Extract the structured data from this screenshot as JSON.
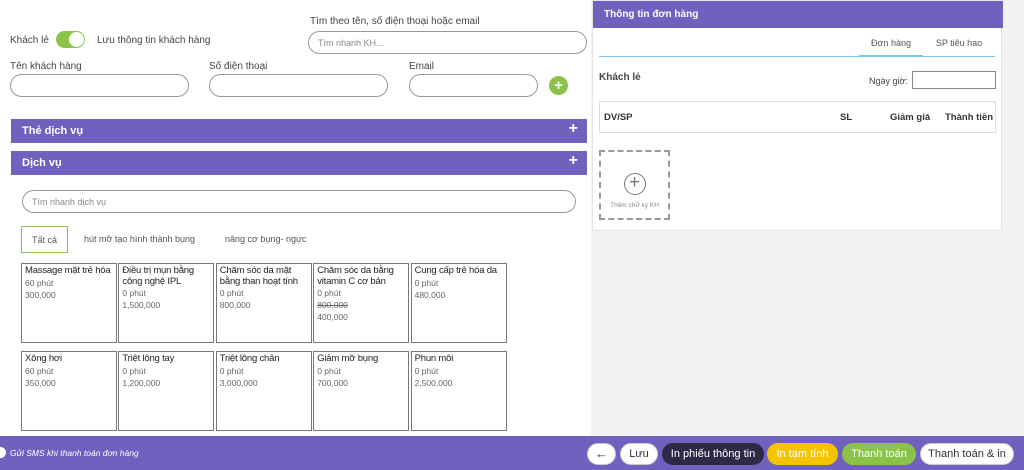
{
  "customer": {
    "walk_in_label": "Khách lẻ",
    "save_info_label": "Lưu thông tin khách hàng",
    "search_label": "Tìm theo tên, số điện thoại hoặc email",
    "search_placeholder": "Tìm nhanh KH...",
    "name_label": "Tên khách hàng",
    "phone_label": "Số điện thoại",
    "email_label": "Email",
    "add_icon": "plus-icon"
  },
  "service_card_section": {
    "title": "Thẻ dịch vụ",
    "expand": "+"
  },
  "service_section": {
    "title": "Dịch vụ",
    "expand": "+",
    "search_placeholder": "Tìm nhanh dịch vụ",
    "tabs": [
      "Tất cả",
      "hút mỡ tạo hình thành bụng",
      "nâng cơ bụng- ngực"
    ],
    "services": [
      {
        "name": "Massage mặt trẻ hóa",
        "duration": "60 phút",
        "price": "300,000",
        "old_price": ""
      },
      {
        "name": "Điều trị mụn bằng công nghệ IPL",
        "duration": "0 phút",
        "price": "1,500,000",
        "old_price": ""
      },
      {
        "name": "Chăm sóc da mặt bằng than hoạt tính",
        "duration": "0 phút",
        "price": "800,000",
        "old_price": ""
      },
      {
        "name": "Chăm sóc da bằng vitamin C cơ bản",
        "duration": "0 phút",
        "price": "400,000",
        "old_price": "800,000"
      },
      {
        "name": "Cung cấp trẻ hóa da",
        "duration": "0 phút",
        "price": "480,000",
        "old_price": ""
      },
      {
        "name": "Xông hơi",
        "duration": "60 phút",
        "price": "350,000",
        "old_price": ""
      },
      {
        "name": "Triệt lông tay",
        "duration": "0 phút",
        "price": "1,200,000",
        "old_price": ""
      },
      {
        "name": "Triệt lông chân",
        "duration": "0 phút",
        "price": "3,000,000",
        "old_price": ""
      },
      {
        "name": "Giảm mỡ bụng",
        "duration": "0 phút",
        "price": "700,000",
        "old_price": ""
      },
      {
        "name": "Phun môi",
        "duration": "0 phút",
        "price": "2,500,000",
        "old_price": ""
      }
    ]
  },
  "order": {
    "title": "Thông tin đơn hàng",
    "tabs": [
      "Đơn hàng",
      "SP tiêu hao"
    ],
    "customer_name": "Khách lẻ",
    "date_label": "Ngày giờ:",
    "columns": [
      "DV/SP",
      "SL",
      "Giảm giá",
      "Thành tiền"
    ],
    "signature_label": "Thêm chữ ký KH",
    "signature_icon": "plus-circle-icon"
  },
  "footer": {
    "sms_label": "Gửi SMS khi thanh toán đơn hàng",
    "back_icon": "arrow-left-icon",
    "buttons": {
      "save": "Lưu",
      "print_info": "In phiếu thông tin",
      "print_temp": "In tạm tính",
      "pay": "Thanh toán",
      "pay_print": "Thanh toán & in"
    },
    "colors": {
      "bar": "#7160bd",
      "dark": "#2e2a45",
      "yellow": "#f5c400",
      "green": "#8bc34a"
    }
  }
}
